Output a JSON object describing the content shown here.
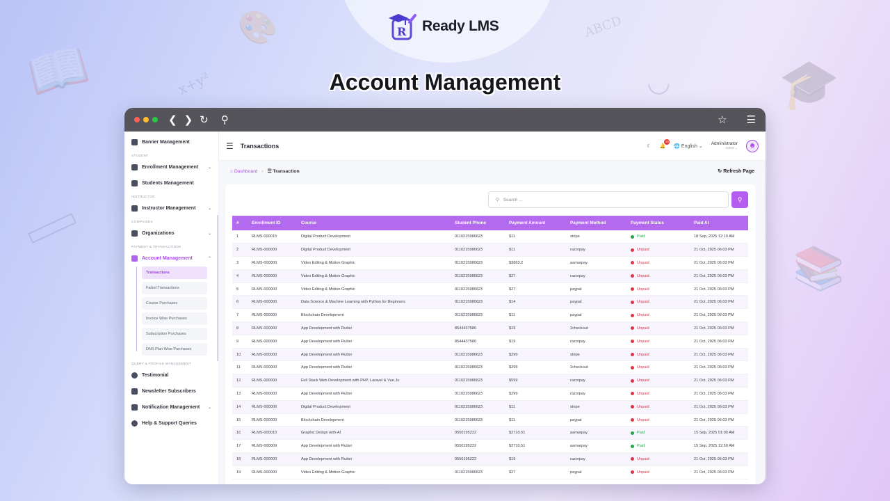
{
  "brand": {
    "name": "Ready LMS",
    "logo_letter": "R"
  },
  "headline": "Account Management",
  "browser": {
    "icons": [
      "back-icon",
      "forward-icon",
      "reload-icon",
      "search-icon",
      "star-icon",
      "menu-icon"
    ]
  },
  "topbar": {
    "title": "Transactions",
    "notifications_count": "10",
    "language": "English",
    "user_name": "Administrator",
    "user_role": "Admin"
  },
  "breadcrumb": {
    "home": "Dashboard",
    "current": "Transaction",
    "refresh": "Refresh Page"
  },
  "search": {
    "placeholder": "Search ..."
  },
  "sidebar": {
    "items": [
      {
        "label": "Banner Management",
        "section": null
      },
      {
        "section": "STUDENT"
      },
      {
        "label": "Enrollment Management",
        "chevron": true
      },
      {
        "label": "Students Management"
      },
      {
        "section": "INSTRUCTOR"
      },
      {
        "label": "Instructor Management",
        "chevron": true
      },
      {
        "section": "COMPANIES"
      },
      {
        "label": "Organizations",
        "chevron": true
      },
      {
        "section": "PAYMENT & TRANSACTIONS"
      },
      {
        "label": "Account Management",
        "chevron": true,
        "active": true
      }
    ],
    "subitems": [
      "Transactions",
      "Failed Transactions",
      "Course Purchases",
      "Invoice Wise Purchases",
      "Subscription Purchases",
      "DNS Plan Wise Purchases"
    ],
    "after_section": "QUERY & PROFILE MANAGEMENT",
    "after_items": [
      "Testimonial",
      "Newsletter Subscribers",
      "Notification Management",
      "Help & Support Queries"
    ]
  },
  "table": {
    "columns": [
      "#",
      "Enrollment ID",
      "Course",
      "Student Phone",
      "Payment Amount",
      "Payment Method",
      "Payment Status",
      "Paid At"
    ],
    "rows": [
      [
        "1",
        "RLMS-000015",
        "Digital Product Development",
        "01102159866​23",
        "$11",
        "stripe",
        "Paid",
        "18 Sep, 2025 12:10 AM"
      ],
      [
        "2",
        "RLMS-000000",
        "Digital Product Development",
        "01102159866​23",
        "$11",
        "razorpay",
        "Unpaid",
        "21 Oct, 2025 06:03 PM"
      ],
      [
        "3",
        "RLMS-000000",
        "Video Editing & Motion Graphic",
        "01102159866​23",
        "$3863.2",
        "aamarpay",
        "Unpaid",
        "21 Oct, 2025 06:03 PM"
      ],
      [
        "4",
        "RLMS-000000",
        "Video Editing & Motion Graphic",
        "01102159866​23",
        "$27",
        "razorpay",
        "Unpaid",
        "21 Oct, 2025 06:03 PM"
      ],
      [
        "5",
        "RLMS-000000",
        "Video Editing & Motion Graphic",
        "01102159866​23",
        "$27",
        "paypal",
        "Unpaid",
        "21 Oct, 2025 06:03 PM"
      ],
      [
        "6",
        "RLMS-000000",
        "Data Science & Machine Learning with Python for Beginners",
        "01102159866​23",
        "$14",
        "paypal",
        "Unpaid",
        "21 Oct, 2025 06:03 PM"
      ],
      [
        "7",
        "RLMS-000000",
        "Blockchain Development",
        "01102159866​23",
        "$11",
        "paypal",
        "Unpaid",
        "21 Oct, 2025 06:03 PM"
      ],
      [
        "8",
        "RLMS-000000",
        "App Development with Flutter",
        "8544437580",
        "$19",
        "2checkout",
        "Unpaid",
        "21 Oct, 2025 06:03 PM"
      ],
      [
        "9",
        "RLMS-000000",
        "App Development with Flutter",
        "8544437580",
        "$19",
        "razorpay",
        "Unpaid",
        "21 Oct, 2025 06:03 PM"
      ],
      [
        "10",
        "RLMS-000000",
        "App Development with Flutter",
        "01102159866​23",
        "$299",
        "stripe",
        "Unpaid",
        "21 Oct, 2025 06:03 PM"
      ],
      [
        "11",
        "RLMS-000000",
        "App Development with Flutter",
        "01102159866​23",
        "$299",
        "2checkout",
        "Unpaid",
        "21 Oct, 2025 06:03 PM"
      ],
      [
        "12",
        "RLMS-000000",
        "Full Stack Web Development with PHP, Laravel & Vue.Js",
        "01102159866​23",
        "$599",
        "razorpay",
        "Unpaid",
        "21 Oct, 2025 06:03 PM"
      ],
      [
        "13",
        "RLMS-000000",
        "App Development with Flutter",
        "01102159866​23",
        "$299",
        "razorpay",
        "Unpaid",
        "21 Oct, 2025 06:03 PM"
      ],
      [
        "14",
        "RLMS-000000",
        "Digital Product Development",
        "01102159866​23",
        "$11",
        "stripe",
        "Unpaid",
        "21 Oct, 2025 06:03 PM"
      ],
      [
        "15",
        "RLMS-000000",
        "Blockchain Development",
        "01102159866​23",
        "$11",
        "paypal",
        "Unpaid",
        "21 Oct, 2025 06:03 PM"
      ],
      [
        "16",
        "RLMS-000010",
        "Graphic Design with-AI",
        "0550195222",
        "$2710.51",
        "aamarpay",
        "Paid",
        "15 Sep, 2025 01:00 AM"
      ],
      [
        "17",
        "RLMS-000009",
        "App Development with Flutter",
        "0550195222",
        "$2710.51",
        "aamarpay",
        "Paid",
        "15 Sep, 2025 12:59 AM"
      ],
      [
        "18",
        "RLMS-000000",
        "App Development with Flutter",
        "0550195222",
        "$19",
        "razorpay",
        "Unpaid",
        "21 Oct, 2025 06:03 PM"
      ],
      [
        "19",
        "RLMS-000000",
        "Video Editing & Motion Graphic",
        "01102159866​23",
        "$27",
        "paypal",
        "Unpaid",
        "21 Oct, 2025 06:03 PM"
      ]
    ]
  }
}
